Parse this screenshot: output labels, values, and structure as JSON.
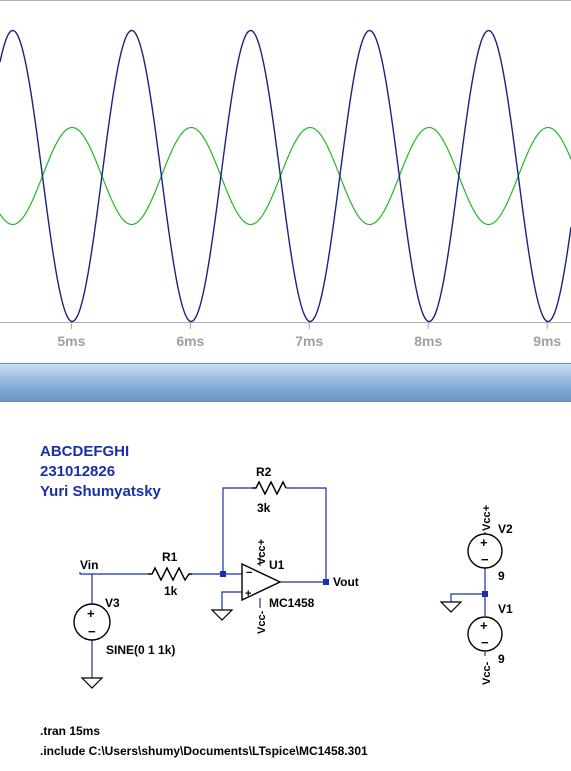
{
  "waveform": {
    "x_ticks": [
      "5ms",
      "6ms",
      "7ms",
      "8ms",
      "9ms"
    ],
    "colors": {
      "vout": "#1a237e",
      "vin": "#22b822",
      "tick": "#a0a0a0",
      "frame": "#b0b0b0"
    }
  },
  "chart_data": {
    "type": "line",
    "x_unit": "ms",
    "xlim": [
      4.4,
      9.2
    ],
    "x_ticks": [
      5,
      6,
      7,
      8,
      9
    ],
    "series": [
      {
        "color": "#1a237e",
        "amplitude": 3,
        "frequency_khz": 1,
        "phase": "inverted"
      },
      {
        "color": "#22b822",
        "amplitude": 1,
        "frequency_khz": 1,
        "phase": "normal"
      }
    ]
  },
  "schematic": {
    "captions": [
      "ABCDEFGHI",
      "231012826",
      "Yuri Shumyatsky"
    ],
    "labels": {
      "r2_name": "R2",
      "r2_value": "3k",
      "r1_name": "R1",
      "r1_value": "1k",
      "vin": "Vin",
      "vout": "Vout",
      "u1_name": "U1",
      "u1_model": "MC1458",
      "vcc_pos": "Vcc+",
      "vcc_neg": "Vcc-",
      "v3_name": "V3",
      "v3_value": "SINE(0 1 1k)",
      "v2_name": "V2",
      "v2_value": "9",
      "v1_name": "V1",
      "v1_value": "9",
      "plus": "+",
      "minus": "−"
    },
    "directives": [
      ".tran 15ms",
      ".include C:\\Users\\shumy\\Documents\\LTspice\\MC1458.301"
    ],
    "colors": {
      "wire": "#1a2fa8",
      "component": "#000000",
      "caption": "#1a2fa8",
      "junction": "#1a2fa8"
    }
  }
}
